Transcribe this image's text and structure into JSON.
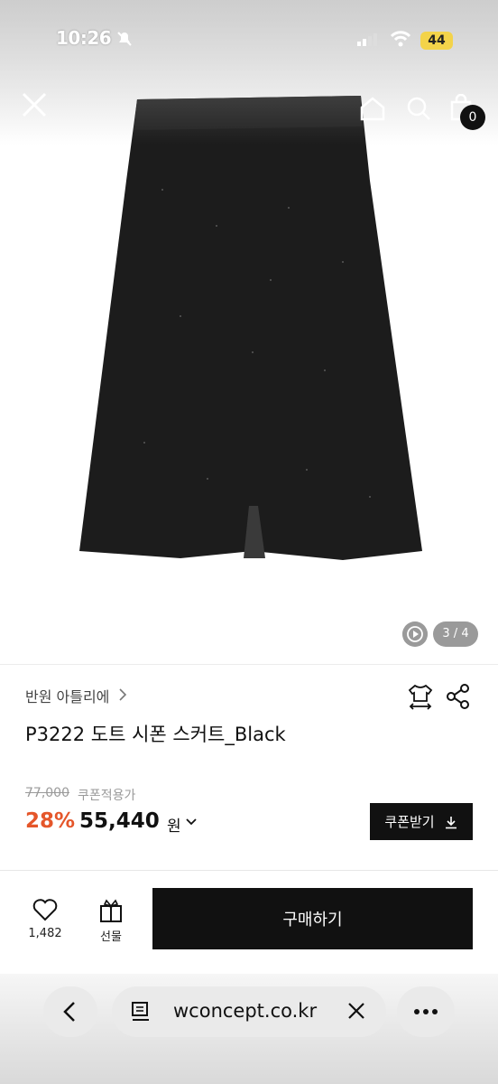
{
  "status": {
    "time": "10:26",
    "battery": "44"
  },
  "header": {
    "cart_count": "0"
  },
  "gallery": {
    "counter": "3 / 4"
  },
  "product": {
    "brand": "반원 아틀리에",
    "name": "P3222 도트 시폰 스커트_Black",
    "original_price": "77,000",
    "price_note": "쿠폰적용가",
    "discount": "28%",
    "price": "55,440",
    "currency": "원",
    "coupon_button": "쿠폰받기"
  },
  "actions": {
    "like_count": "1,482",
    "gift_label": "선물",
    "buy_label": "구매하기"
  },
  "browser": {
    "url": "wconcept.co.kr"
  },
  "colors": {
    "accent_discount": "#e5562a",
    "primary": "#111111"
  }
}
